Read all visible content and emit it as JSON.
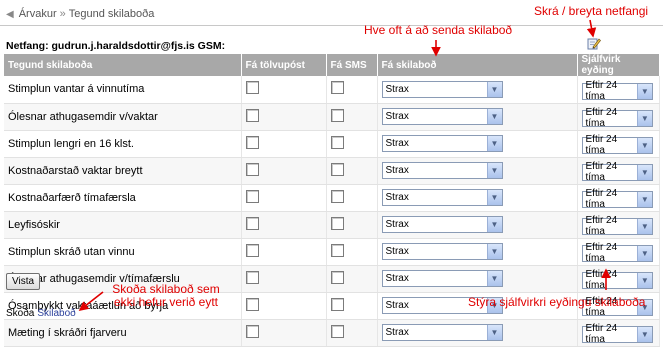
{
  "breadcrumb": {
    "back": "Árvakur",
    "separator": "»",
    "current": "Tegund skilaboða"
  },
  "contact": {
    "label": "Netfang: gudrun.j.haraldsdottir@fjs.is GSM:"
  },
  "table": {
    "headers": [
      "Tegund skilaboða",
      "Fá tölvupóst",
      "Fá SMS",
      "Fá skilaboð",
      "Sjálfvirk eyðing"
    ],
    "rows": [
      {
        "type": "Stimplun vantar á vinnutíma",
        "email": false,
        "sms": false,
        "frequency": "Strax",
        "deletion": "Eftir 24 tíma"
      },
      {
        "type": "Ólesnar athugasemdir v/vaktar",
        "email": false,
        "sms": false,
        "frequency": "Strax",
        "deletion": "Eftir 24 tíma"
      },
      {
        "type": "Stimplun lengri en 16 klst.",
        "email": false,
        "sms": false,
        "frequency": "Strax",
        "deletion": "Eftir 24 tíma"
      },
      {
        "type": "Kostnaðarstað vaktar breytt",
        "email": false,
        "sms": false,
        "frequency": "Strax",
        "deletion": "Eftir 24 tíma"
      },
      {
        "type": "Kostnaðarfærð tímafærsla",
        "email": false,
        "sms": false,
        "frequency": "Strax",
        "deletion": "Eftir 24 tíma"
      },
      {
        "type": "Leyfisóskir",
        "email": false,
        "sms": false,
        "frequency": "Strax",
        "deletion": "Eftir 24 tíma"
      },
      {
        "type": "Stimplun skráð utan vinnu",
        "email": false,
        "sms": false,
        "frequency": "Strax",
        "deletion": "Eftir 24 tíma"
      },
      {
        "type": "Ólesnar athugasemdir v/tímafærslu",
        "email": false,
        "sms": false,
        "frequency": "Strax",
        "deletion": "Eftir 24 tíma"
      },
      {
        "type": "Ósamþykkt vaktaáætlun að byrja",
        "email": false,
        "sms": false,
        "frequency": "Strax",
        "deletion": "Eftir 24 tíma"
      },
      {
        "type": "Mæting í skráðri fjarveru",
        "email": false,
        "sms": false,
        "frequency": "Strax",
        "deletion": "Eftir 24 tíma"
      }
    ]
  },
  "buttons": {
    "save": "Vista"
  },
  "footer": {
    "prefix": "Skoða",
    "link": "Skilaboð"
  },
  "annotations": {
    "edit_email": "Skrá / breyta netfangi",
    "frequency": "Hve oft á að senda skilaboð",
    "unread": "Skoða skilaboð sem ekki hefur verið eytt",
    "auto_delete": "Stýra sjálfvirkri eyðingu skilaboða"
  },
  "colors": {
    "header_bg": "#a8a8a8",
    "annotation": "#e00000",
    "link": "#2a3f9a"
  },
  "icons": {
    "back": "back-arrow-icon",
    "edit": "pencil-edit-icon",
    "dropdown": "chevron-down-icon"
  }
}
